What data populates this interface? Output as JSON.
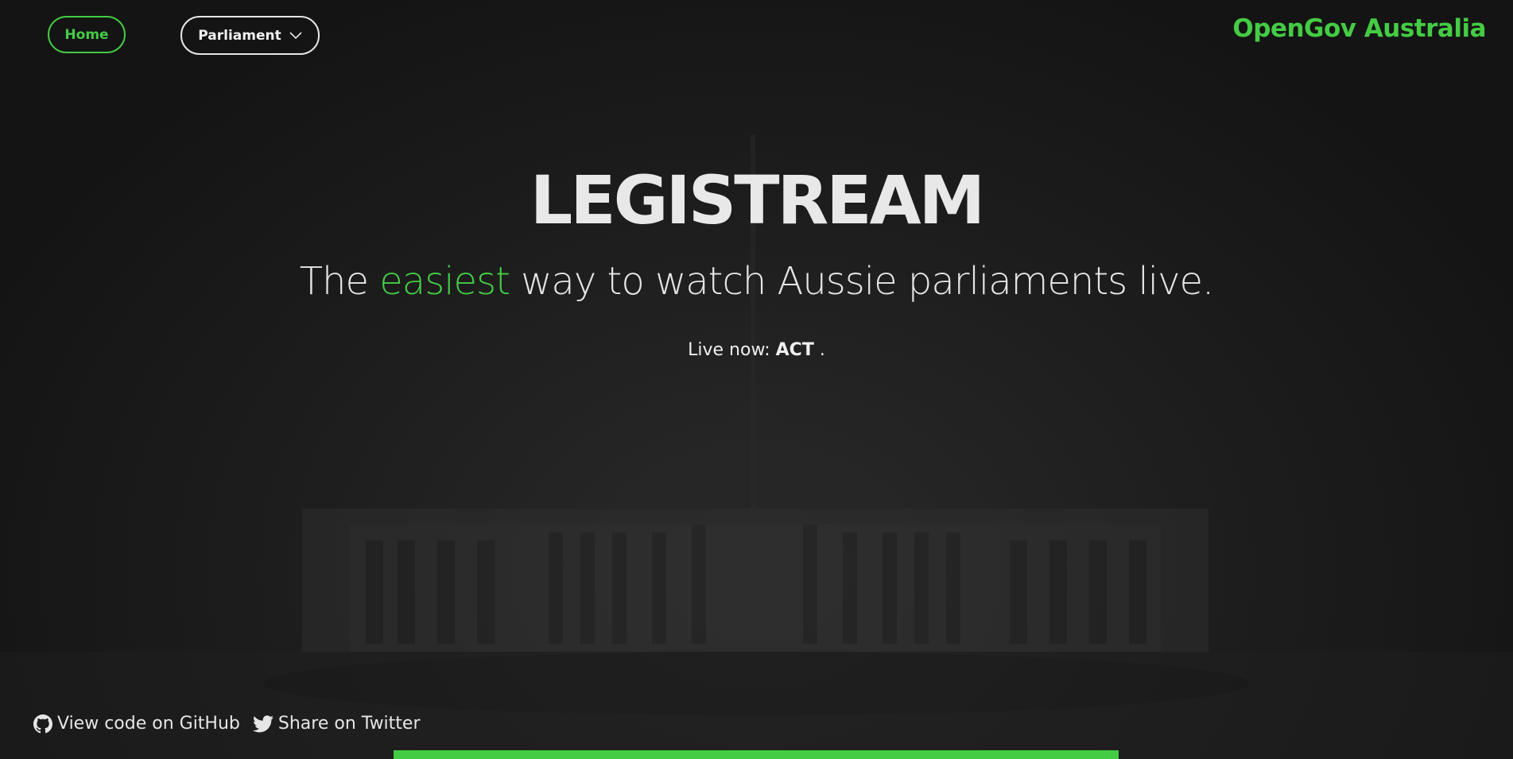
{
  "nav": {
    "home_label": "Home",
    "parliament_label": "Parliament",
    "brand": "OpenGov Australia"
  },
  "hero": {
    "title": "LEGISTREAM",
    "subtitle_before": "The ",
    "subtitle_accent": "easiest",
    "subtitle_after": " way to watch Aussie parliaments live.",
    "live_prefix": "Live now: ",
    "live_value": "ACT",
    "live_suffix": " ."
  },
  "footer": {
    "github_label": "View code on GitHub",
    "twitter_label": "Share on Twitter"
  },
  "progress": {
    "fraction": 1.0
  },
  "colors": {
    "accent": "#44cc44",
    "background": "#141414",
    "text": "#e6e6e6"
  },
  "icons": {
    "dropdown": "chevron-down-icon",
    "github": "github-icon",
    "twitter": "twitter-icon"
  }
}
